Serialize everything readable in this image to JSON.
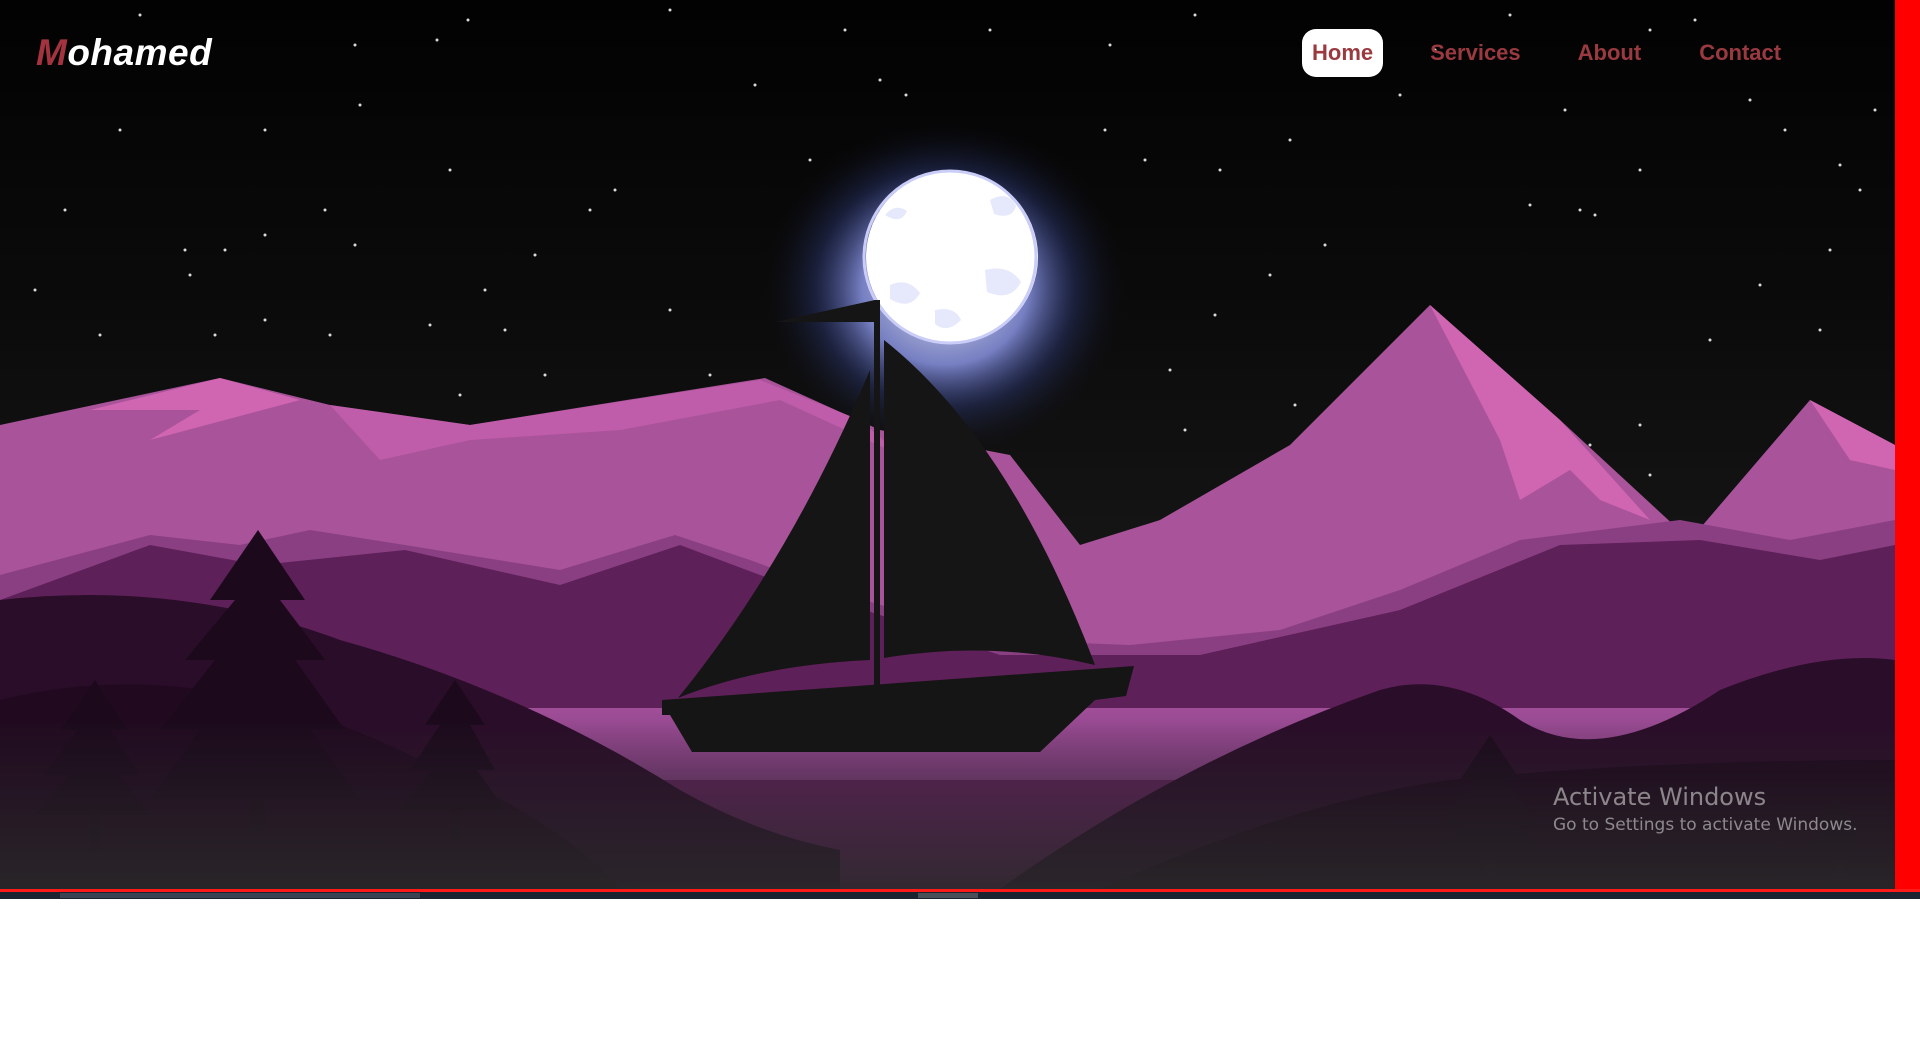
{
  "logo": {
    "first_letter": "M",
    "rest": "ohamed"
  },
  "nav": {
    "items": [
      {
        "label": "Home",
        "active": true
      },
      {
        "label": "Services",
        "active": false
      },
      {
        "label": "About",
        "active": false
      },
      {
        "label": "Contact",
        "active": false
      }
    ]
  },
  "hero": {
    "scene_elements": [
      "stars",
      "moon",
      "mountains",
      "trees",
      "sailboat",
      "lake"
    ]
  },
  "watermark": {
    "title": "Activate Windows",
    "subtitle": "Go to Settings to activate Windows."
  },
  "colors": {
    "accent": "#9a3a40",
    "logo_accent": "#a3343f",
    "border": "#ff0000",
    "mountain_light": "#a9539a",
    "mountain_pink": "#d066b2",
    "mountain_dark": "#5e2059",
    "ground_dark": "#2a0d29",
    "moon": "#ffffff",
    "boat": "#151515"
  }
}
